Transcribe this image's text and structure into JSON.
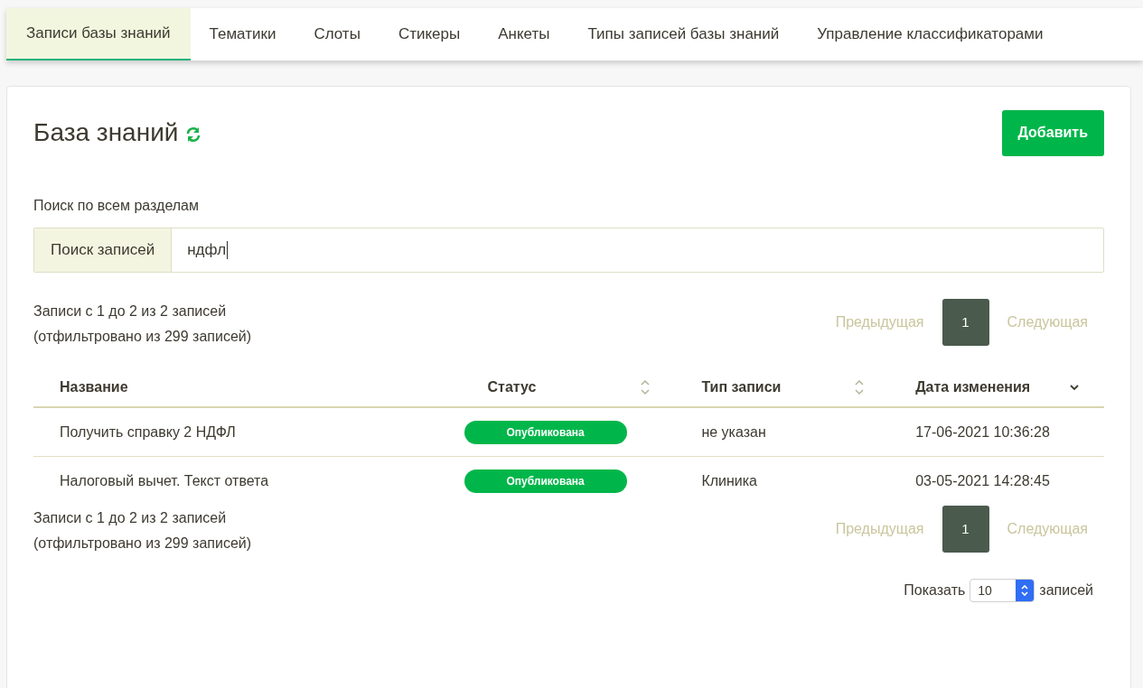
{
  "tabs": [
    {
      "label": "Записи базы знаний",
      "selected": true
    },
    {
      "label": "Тематики",
      "selected": false
    },
    {
      "label": "Слоты",
      "selected": false
    },
    {
      "label": "Стикеры",
      "selected": false
    },
    {
      "label": "Анкеты",
      "selected": false
    },
    {
      "label": "Типы записей базы знаний",
      "selected": false
    },
    {
      "label": "Управление классификаторами",
      "selected": false
    }
  ],
  "title": "База знаний",
  "add_button": "Добавить",
  "search": {
    "section_label": "Поиск по всем разделам",
    "addon": "Поиск записей",
    "value": "ндфл"
  },
  "info_top": [
    "Записи с 1 до 2 из 2 записей",
    "(отфильтровано из 299 записей)"
  ],
  "pagination_top": {
    "previous": "Предыдущая",
    "next": "Следующая",
    "previous_disabled": true,
    "next_disabled": true,
    "pages": [
      {
        "label": "1",
        "selected": true
      }
    ]
  },
  "table": {
    "columns": [
      {
        "label": "Название",
        "sortable": false,
        "sorted_descending": false
      },
      {
        "label": "Статус",
        "sortable": true,
        "sorted_descending": false
      },
      {
        "label": "Тип записи",
        "sortable": true,
        "sorted_descending": false
      },
      {
        "label": "Дата изменения",
        "sortable": true,
        "sorted_descending": true
      }
    ],
    "rows": [
      {
        "name": "Получить справку 2 НДФЛ",
        "status": "Опубликована",
        "type": "не указан",
        "date": "17-06-2021 10:36:28"
      },
      {
        "name": "Налоговый вычет. Текст ответа",
        "status": "Опубликована",
        "type": "Клиника",
        "date": "03-05-2021 14:28:45"
      }
    ]
  },
  "info_bottom": [
    "Записи с 1 до 2 из 2 записей",
    "(отфильтровано из 299 записей)"
  ],
  "pagination_bottom": {
    "previous": "Предыдущая",
    "next": "Следующая",
    "previous_disabled": true,
    "next_disabled": true,
    "pages": [
      {
        "label": "1",
        "selected": true
      }
    ]
  },
  "page_length": {
    "before": "Показать",
    "value": "10",
    "after": "записей"
  }
}
